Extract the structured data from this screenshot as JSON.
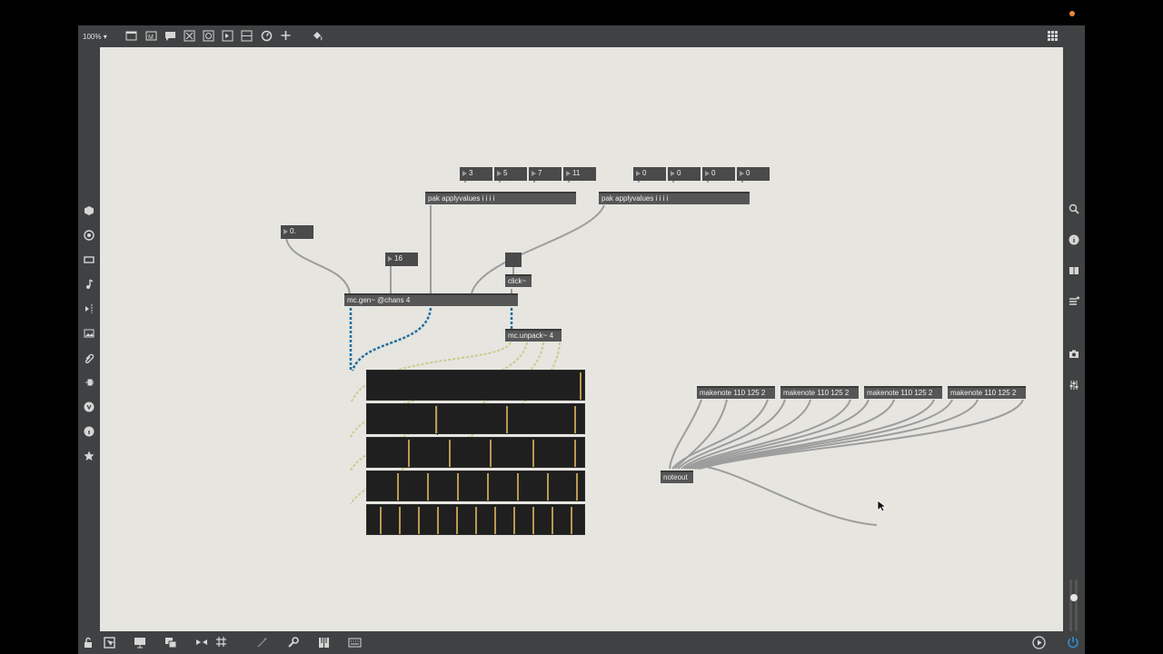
{
  "toolbar": {
    "zoom": "100%"
  },
  "patch": {
    "pak_left": {
      "label": "pak applyvalues i i i i",
      "values": [
        "3",
        "5",
        "7",
        "11"
      ]
    },
    "pak_right": {
      "label": "pak applyvalues i i i i",
      "values": [
        "0",
        "0",
        "0",
        "0"
      ]
    },
    "float_box": "0.",
    "int_box": "16",
    "click_obj": "click~",
    "mcgen": "mc.gen~ @chans 4",
    "unpack": "mc.unpack~ 4",
    "makenotes": [
      "makenote 110 125 2",
      "makenote 110 125 2",
      "makenote 110 125 2",
      "makenote 110 125 2"
    ],
    "noteout": "noteout"
  },
  "colors": {
    "canvas": "#e6e5e0",
    "chrome": "#3f4143",
    "mc_cord": "#1f6f9c",
    "signal_cord": "#c9cc8a",
    "scope_tick": "#b89a52"
  }
}
